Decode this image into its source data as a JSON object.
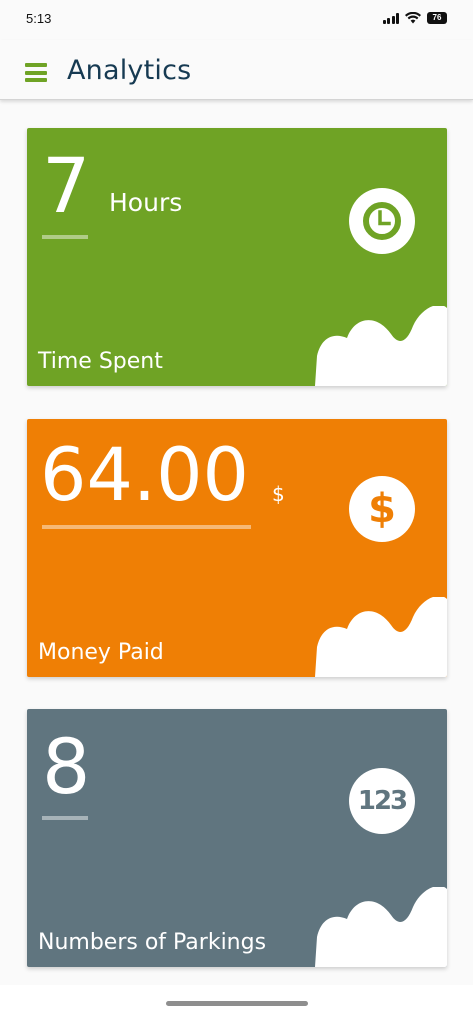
{
  "status_bar": {
    "time": "5:13",
    "battery": "76"
  },
  "app_bar": {
    "title": "Analytics",
    "menu_icon": "hamburger-menu-icon"
  },
  "cards": [
    {
      "value": "7",
      "unit": "Hours",
      "label": "Time Spent",
      "icon": "clock-icon",
      "color": "#6fa325"
    },
    {
      "value": "64.00",
      "unit": "$",
      "label": "Money Paid",
      "icon": "dollar-icon",
      "color": "#ef7f05"
    },
    {
      "value": "8",
      "unit": "",
      "label": "Numbers of Parkings",
      "icon": "numbers-123-icon",
      "icon_text": "123",
      "color": "#60757f"
    }
  ]
}
